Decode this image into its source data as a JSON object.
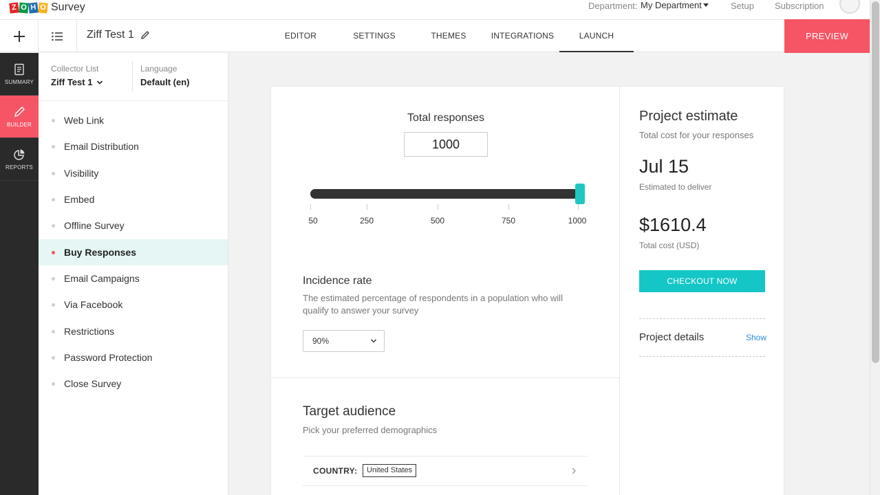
{
  "brand": {
    "logo_letters": [
      "Z",
      "O",
      "H",
      "O"
    ],
    "product": "Survey"
  },
  "topbar": {
    "department_label": "Department:",
    "department_value": "My Department",
    "setup": "Setup",
    "subscription": "Subscription"
  },
  "header": {
    "survey_title": "Ziff Test 1",
    "tabs": [
      {
        "label": "EDITOR"
      },
      {
        "label": "SETTINGS"
      },
      {
        "label": "THEMES"
      },
      {
        "label": "INTEGRATIONS"
      },
      {
        "label": "LAUNCH",
        "active": true
      }
    ],
    "preview": "PREVIEW"
  },
  "rail": {
    "items": [
      {
        "label": "SUMMARY",
        "icon": "document-icon"
      },
      {
        "label": "BUILDER",
        "icon": "pencil-icon",
        "active": true
      },
      {
        "label": "REPORTS",
        "icon": "pie-chart-icon"
      }
    ]
  },
  "sidepanel": {
    "collector_label": "Collector List",
    "collector_value": "Ziff Test 1",
    "language_label": "Language",
    "language_value": "Default (en)",
    "items": [
      {
        "label": "Web Link"
      },
      {
        "label": "Email Distribution"
      },
      {
        "label": "Visibility"
      },
      {
        "label": "Embed"
      },
      {
        "label": "Offline Survey"
      },
      {
        "label": "Buy Responses",
        "active": true
      },
      {
        "label": "Email Campaigns"
      },
      {
        "label": "Via Facebook"
      },
      {
        "label": "Restrictions"
      },
      {
        "label": "Password Protection"
      },
      {
        "label": "Close Survey"
      }
    ]
  },
  "responses": {
    "label": "Total responses",
    "value": "1000",
    "slider_level": 1.0,
    "ticks": [
      "50",
      "250",
      "500",
      "750",
      "1000"
    ]
  },
  "incidence": {
    "title": "Incidence rate",
    "description": "The estimated percentage of respondents in a population who will qualify to answer your survey",
    "selected": "90%"
  },
  "audience": {
    "title": "Target audience",
    "subtitle": "Pick your preferred demographics",
    "country_label": "COUNTRY:",
    "country_value": "United States"
  },
  "estimate": {
    "title": "Project estimate",
    "subtitle": "Total cost for your responses",
    "date": "Jul 15",
    "date_label": "Estimated to deliver",
    "cost": "$1610.4",
    "cost_label": "Total cost (USD)",
    "checkout": "CHECKOUT NOW",
    "details_label": "Project details",
    "details_toggle": "Show"
  },
  "colors": {
    "accent_red": "#f55565",
    "accent_teal": "#14c6c6",
    "link_blue": "#2d8bd8",
    "rail_bg": "#2a2a2a"
  }
}
